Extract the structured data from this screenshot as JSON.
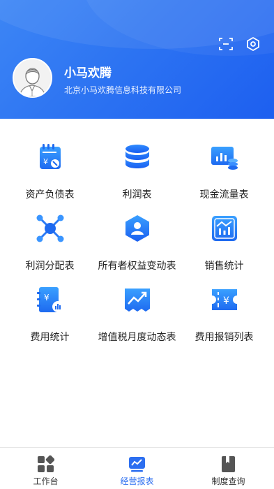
{
  "header": {
    "company_short": "小马欢腾",
    "company_full": "北京小马欢腾信息科技有限公司",
    "scan_icon": "scan-icon",
    "settings_icon": "settings-icon",
    "colors": {
      "gradient_start": "#3d86f5",
      "gradient_end": "#1d5ff0"
    }
  },
  "reports": [
    {
      "label": "资产负债表",
      "icon": "balance-sheet-icon"
    },
    {
      "label": "利润表",
      "icon": "database-icon"
    },
    {
      "label": "现金流量表",
      "icon": "cash-flow-icon"
    },
    {
      "label": "利润分配表",
      "icon": "network-icon"
    },
    {
      "label": "所有者权益变动表",
      "icon": "owner-equity-icon"
    },
    {
      "label": "销售统计",
      "icon": "sales-chart-icon"
    },
    {
      "label": "费用统计",
      "icon": "expense-icon"
    },
    {
      "label": "增值税月度动态表",
      "icon": "trend-icon"
    },
    {
      "label": "费用报销列表",
      "icon": "reimbursement-icon"
    }
  ],
  "tabbar": {
    "active_color": "#2d6ff0",
    "tabs": [
      {
        "label": "工作台",
        "icon": "workbench-icon",
        "active": false
      },
      {
        "label": "经营报表",
        "icon": "report-icon",
        "active": true
      },
      {
        "label": "制度查询",
        "icon": "book-icon",
        "active": false
      }
    ]
  }
}
